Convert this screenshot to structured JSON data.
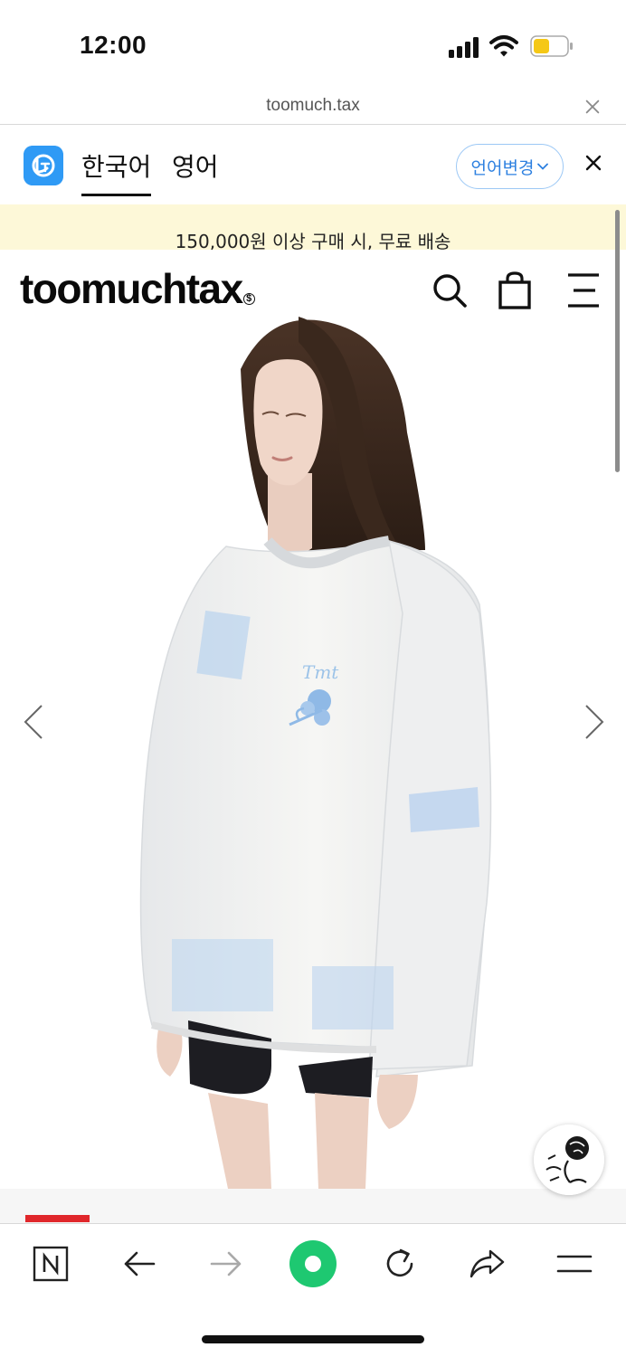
{
  "status_bar": {
    "time": "12:00",
    "icons": [
      "signal-icon",
      "wifi-icon",
      "battery-icon"
    ],
    "battery_color": "#f5c816"
  },
  "browser": {
    "url": "toomuch.tax",
    "close_icon": "close-icon"
  },
  "translate_bar": {
    "logo_icon": "papago-translate-icon",
    "tabs": [
      {
        "label": "한국어",
        "active": true
      },
      {
        "label": "영어",
        "active": false
      }
    ],
    "change_language_label": "언어변경",
    "accent_color": "#2d80e0"
  },
  "promo": {
    "text": "150,000원 이상 구매 시, 무료 배송",
    "background": "#fdf8d8"
  },
  "site": {
    "logo_text": "toomuchtax",
    "logo_mark": "$",
    "icons": [
      "search-icon",
      "shopping-bag-icon",
      "menu-icon"
    ]
  },
  "product": {
    "image_alt": "Model wearing white sweater with light blue print",
    "print_text": "Tmt",
    "print_color": "#9cc3e8",
    "prev_icon": "chevron-left-icon",
    "next_icon": "chevron-right-icon",
    "floating_icon": "rose-icon"
  },
  "toolbar": {
    "icons": [
      "naver-n-icon",
      "back-arrow-icon",
      "forward-arrow-icon",
      "home-green-icon",
      "reload-icon",
      "share-icon",
      "menu-lines-icon"
    ],
    "accent_green": "#1ec871",
    "marker_color": "#e0272b"
  }
}
